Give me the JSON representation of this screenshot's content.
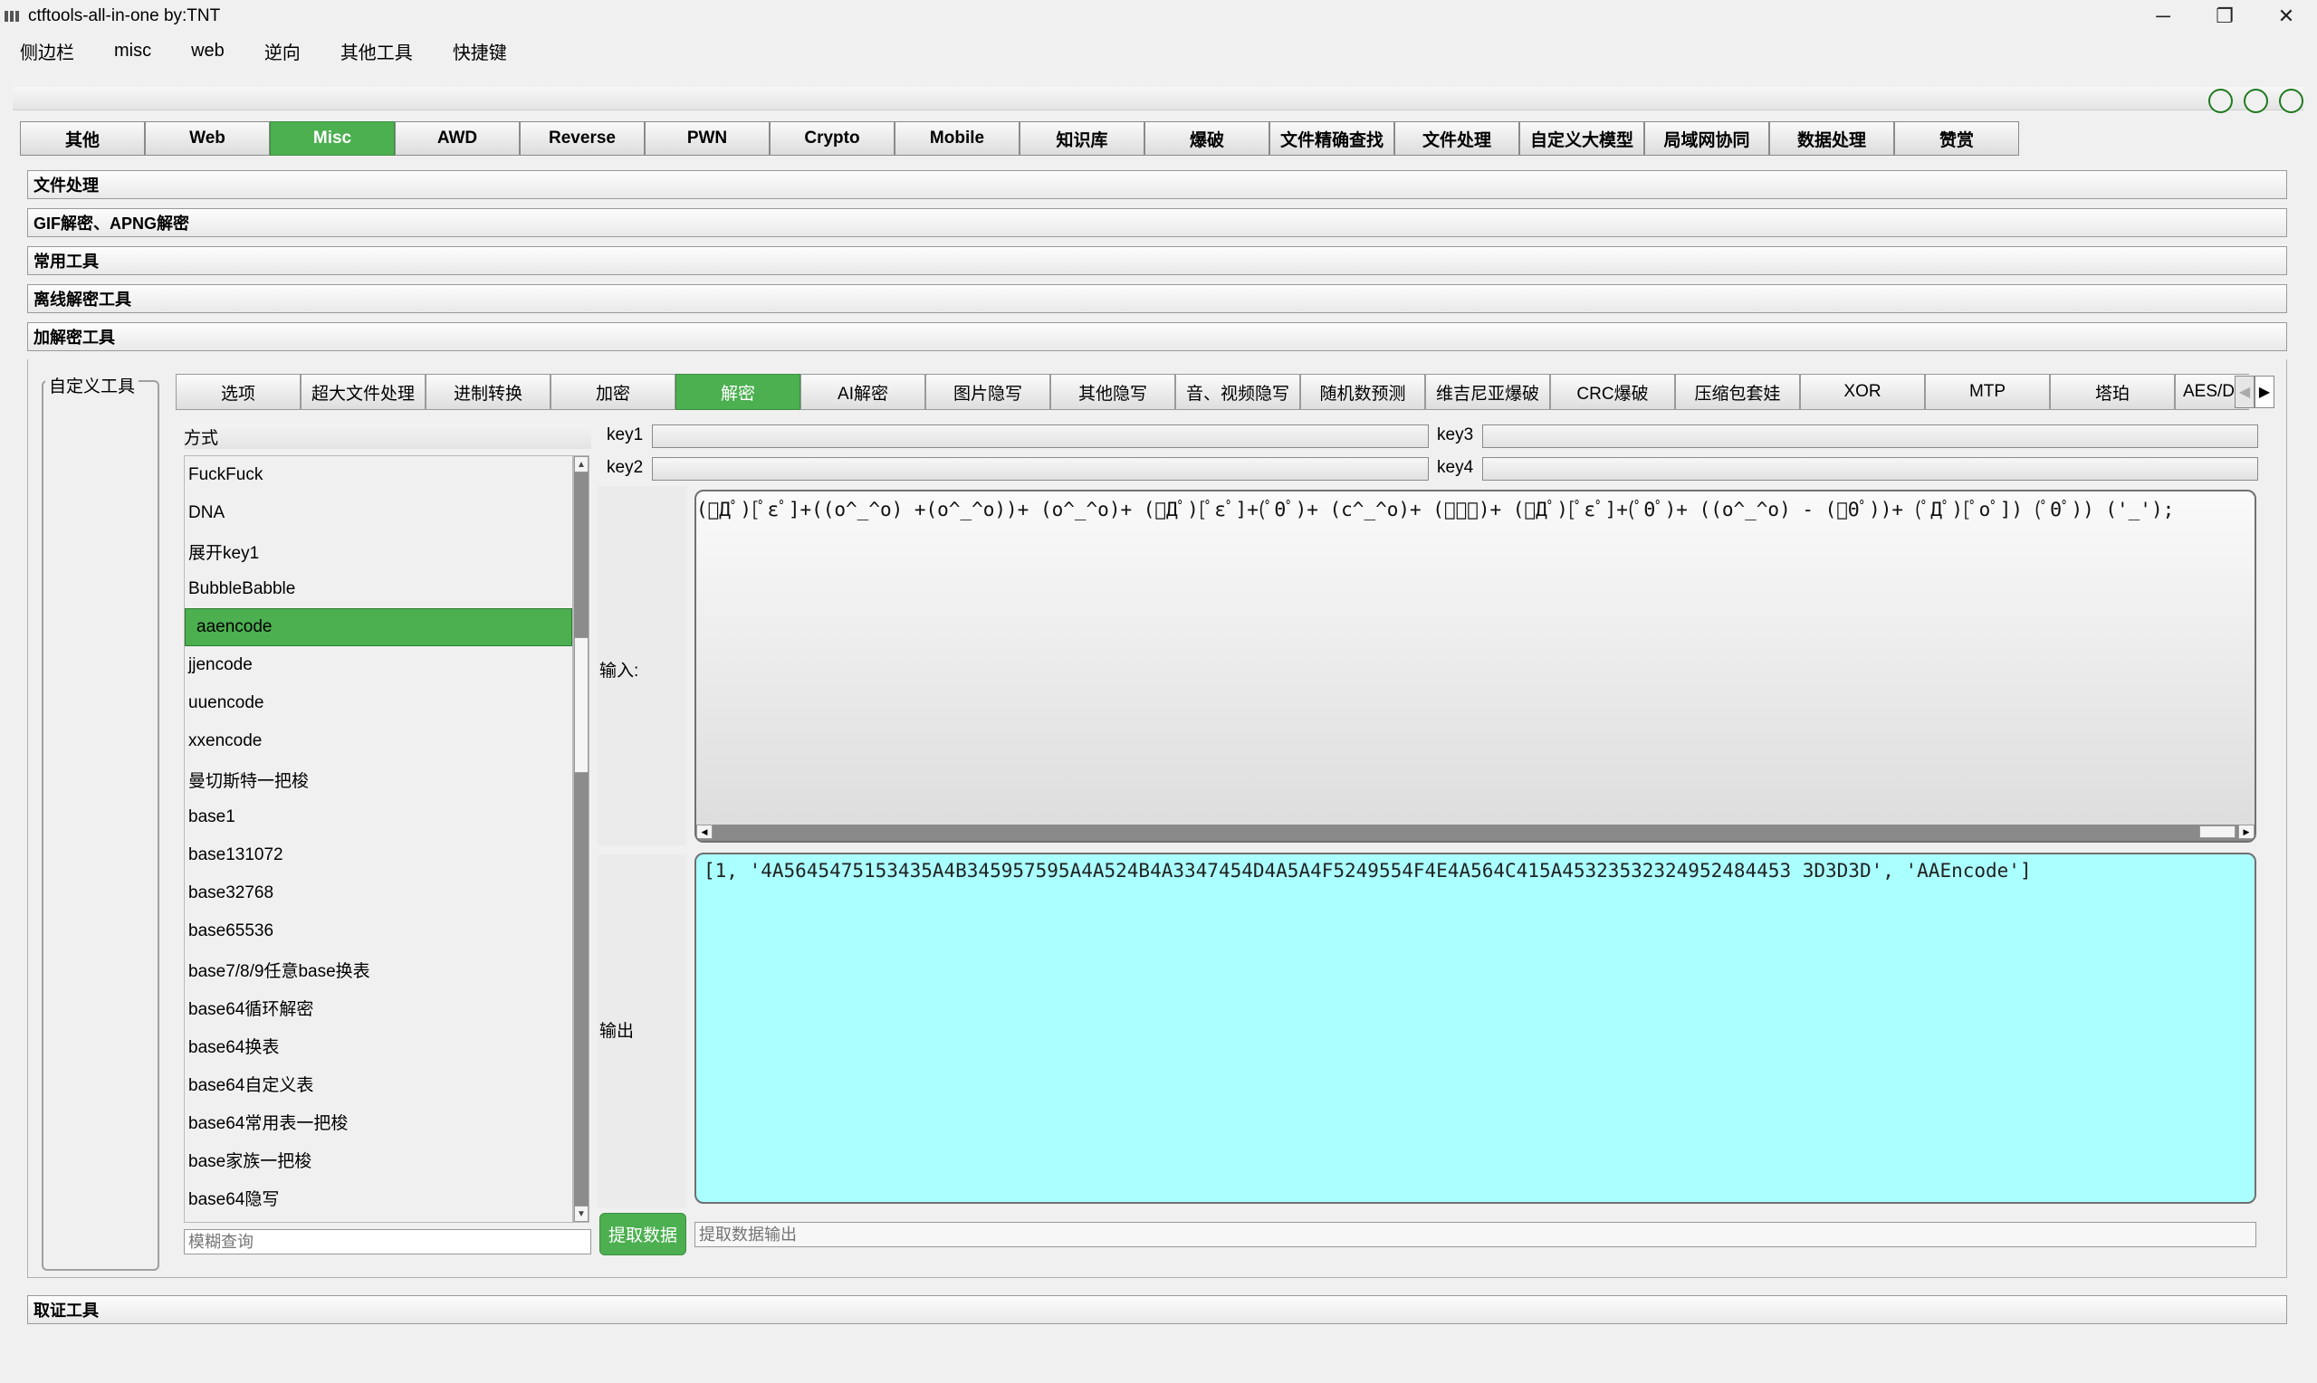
{
  "window": {
    "title": "ctftools-all-in-one   by:TNT",
    "controls": {
      "minimize": "─",
      "restore": "❐",
      "close": "✕"
    }
  },
  "menu": [
    "侧边栏",
    "misc",
    "web",
    "逆向",
    "其他工具",
    "快捷键"
  ],
  "main_tabs": [
    "其他",
    "Web",
    "Misc",
    "AWD",
    "Reverse",
    "PWN",
    "Crypto",
    "Mobile",
    "知识库",
    "爆破",
    "文件精确查找",
    "文件处理",
    "自定义大模型",
    "局域网协同",
    "数据处理",
    "赞赏"
  ],
  "main_tabs_active": "Misc",
  "accordion": [
    "文件处理",
    "GIF解密、APNG解密",
    "常用工具",
    "离线解密工具",
    "加解密工具"
  ],
  "custom_tool_group": "自定义工具",
  "sub_tabs": [
    "选项",
    "超大文件处理",
    "进制转换",
    "加密",
    "解密",
    "AI解密",
    "图片隐写",
    "其他隐写",
    "音、视频隐写",
    "随机数预测",
    "维吉尼亚爆破",
    "CRC爆破",
    "压缩包套娃",
    "XOR",
    "MTP",
    "塔珀",
    "AES/D"
  ],
  "sub_tabs_active": "解密",
  "method_label": "方式",
  "methods": [
    "FuckFuck",
    "DNA",
    "展开key1",
    "BubbleBabble",
    "aaencode",
    "jjencode",
    "uuencode",
    "xxencode",
    "曼切斯特一把梭",
    "base1",
    "base131072",
    "base32768",
    "base65536",
    "base7/8/9任意base换表",
    "base64循环解密",
    "base64换表",
    "base64自定义表",
    "base64常用表一把梭",
    "base家族一把梭",
    "base64隐写"
  ],
  "method_selected": "aaencode",
  "search_placeholder": "模糊查询",
  "keys": {
    "key1_label": "key1",
    "key1_value": "",
    "key2_label": "key2",
    "key2_value": "",
    "key3_label": "key3",
    "key3_value": "",
    "key4_label": "key4",
    "key4_value": ""
  },
  "input": {
    "label": "输入:",
    "value": "(ﾟДﾟ)[ﾟεﾟ]+((o^_^o) +(o^_^o))+ (o^_^o)+ (ﾟДﾟ)[ﾟεﾟ]+(ﾟΘﾟ)+ (c^_^o)+ (ﾟｰﾟ)+ (ﾟДﾟ)[ﾟεﾟ]+(ﾟΘﾟ)+ ((o^_^o) - (ﾟΘﾟ))+ (ﾟДﾟ)[ﾟoﾟ]) (ﾟΘﾟ)) ('_');"
  },
  "output": {
    "label": "输出",
    "value": "[1, '4A5645475153435A4B345957595A4A524B4A3347454D4A5A4F5249554F4E4A564C415A45323532324952484453 3D3D3D', 'AAEncode']"
  },
  "extract": {
    "button": "提取数据",
    "placeholder": "提取数据输出"
  },
  "forensics_header": "取证工具",
  "colors": {
    "accent_green": "#4caf50",
    "output_bg": "#aaffff"
  }
}
